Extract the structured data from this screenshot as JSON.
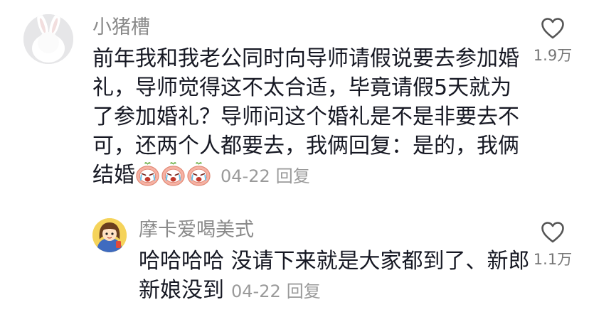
{
  "comments": [
    {
      "username": "小猪槽",
      "text_lines": [
        "前年我和我老公同时向导师请假说要去参加婚",
        "礼，导师觉得这不太合适，毕竟请假5天就为",
        "了参加婚礼？导师问这个婚礼是不是非要去不",
        "可，还两个人都要去，我俩回复：是的，我俩",
        "结婚"
      ],
      "emoji": [
        "crying-face-emoji",
        "crying-face-emoji",
        "crying-face-emoji"
      ],
      "date": "04-22",
      "reply_label": "回复",
      "like_count": "1.9万",
      "avatar": "white-rabbit-avatar"
    },
    {
      "username": "摩卡爱喝美式",
      "text_lines": [
        "哈哈哈哈 没请下来就是大家都到了、新郎",
        "新娘没到"
      ],
      "date": "04-22",
      "reply_label": "回复",
      "like_count": "1.1万",
      "avatar": "cartoon-girl-avatar"
    }
  ],
  "colors": {
    "username": "#8a8a8a",
    "text": "#161823",
    "meta": "#9a9a9a",
    "like_count": "#757575",
    "icon_stroke": "#555555"
  },
  "icons": {
    "like": "heart-outline-icon"
  }
}
